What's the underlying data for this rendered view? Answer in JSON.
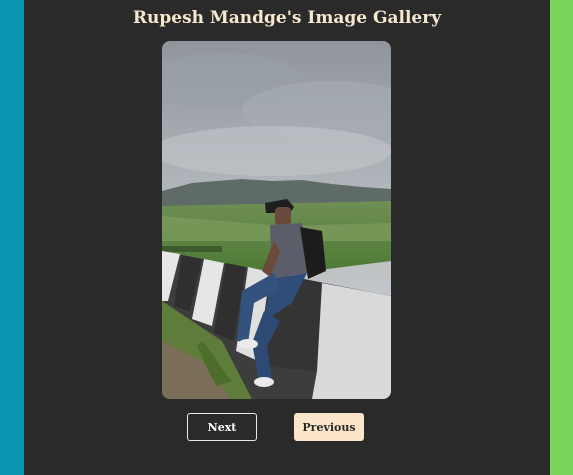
{
  "gallery": {
    "title": "Rupesh Mandge's Image Gallery",
    "next_label": "Next",
    "previous_label": "Previous"
  },
  "colors": {
    "left_stripe": "#0b97b3",
    "right_stripe": "#7ad35a",
    "panel_background": "#2a2a2a",
    "title_text": "#f6e7cf",
    "previous_button_background": "#fbe6cb"
  }
}
